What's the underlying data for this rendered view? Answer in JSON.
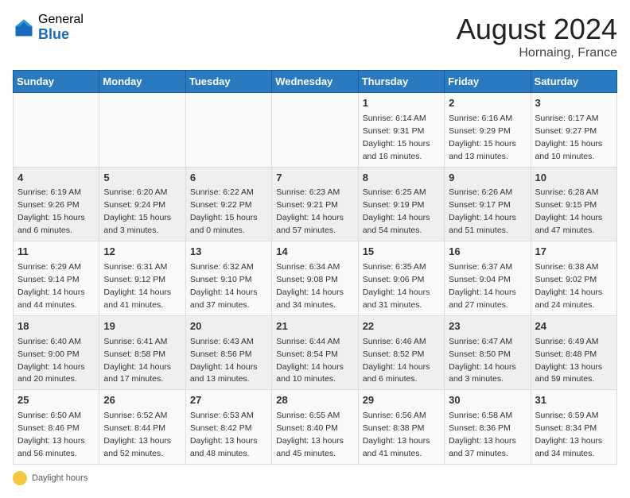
{
  "header": {
    "logo_general": "General",
    "logo_blue": "Blue",
    "month_year": "August 2024",
    "location": "Hornaing, France"
  },
  "footer": {
    "label": "Daylight hours"
  },
  "days_of_week": [
    "Sunday",
    "Monday",
    "Tuesday",
    "Wednesday",
    "Thursday",
    "Friday",
    "Saturday"
  ],
  "weeks": [
    [
      {
        "day": "",
        "info": ""
      },
      {
        "day": "",
        "info": ""
      },
      {
        "day": "",
        "info": ""
      },
      {
        "day": "",
        "info": ""
      },
      {
        "day": "1",
        "info": "Sunrise: 6:14 AM\nSunset: 9:31 PM\nDaylight: 15 hours and 16 minutes."
      },
      {
        "day": "2",
        "info": "Sunrise: 6:16 AM\nSunset: 9:29 PM\nDaylight: 15 hours and 13 minutes."
      },
      {
        "day": "3",
        "info": "Sunrise: 6:17 AM\nSunset: 9:27 PM\nDaylight: 15 hours and 10 minutes."
      }
    ],
    [
      {
        "day": "4",
        "info": "Sunrise: 6:19 AM\nSunset: 9:26 PM\nDaylight: 15 hours and 6 minutes."
      },
      {
        "day": "5",
        "info": "Sunrise: 6:20 AM\nSunset: 9:24 PM\nDaylight: 15 hours and 3 minutes."
      },
      {
        "day": "6",
        "info": "Sunrise: 6:22 AM\nSunset: 9:22 PM\nDaylight: 15 hours and 0 minutes."
      },
      {
        "day": "7",
        "info": "Sunrise: 6:23 AM\nSunset: 9:21 PM\nDaylight: 14 hours and 57 minutes."
      },
      {
        "day": "8",
        "info": "Sunrise: 6:25 AM\nSunset: 9:19 PM\nDaylight: 14 hours and 54 minutes."
      },
      {
        "day": "9",
        "info": "Sunrise: 6:26 AM\nSunset: 9:17 PM\nDaylight: 14 hours and 51 minutes."
      },
      {
        "day": "10",
        "info": "Sunrise: 6:28 AM\nSunset: 9:15 PM\nDaylight: 14 hours and 47 minutes."
      }
    ],
    [
      {
        "day": "11",
        "info": "Sunrise: 6:29 AM\nSunset: 9:14 PM\nDaylight: 14 hours and 44 minutes."
      },
      {
        "day": "12",
        "info": "Sunrise: 6:31 AM\nSunset: 9:12 PM\nDaylight: 14 hours and 41 minutes."
      },
      {
        "day": "13",
        "info": "Sunrise: 6:32 AM\nSunset: 9:10 PM\nDaylight: 14 hours and 37 minutes."
      },
      {
        "day": "14",
        "info": "Sunrise: 6:34 AM\nSunset: 9:08 PM\nDaylight: 14 hours and 34 minutes."
      },
      {
        "day": "15",
        "info": "Sunrise: 6:35 AM\nSunset: 9:06 PM\nDaylight: 14 hours and 31 minutes."
      },
      {
        "day": "16",
        "info": "Sunrise: 6:37 AM\nSunset: 9:04 PM\nDaylight: 14 hours and 27 minutes."
      },
      {
        "day": "17",
        "info": "Sunrise: 6:38 AM\nSunset: 9:02 PM\nDaylight: 14 hours and 24 minutes."
      }
    ],
    [
      {
        "day": "18",
        "info": "Sunrise: 6:40 AM\nSunset: 9:00 PM\nDaylight: 14 hours and 20 minutes."
      },
      {
        "day": "19",
        "info": "Sunrise: 6:41 AM\nSunset: 8:58 PM\nDaylight: 14 hours and 17 minutes."
      },
      {
        "day": "20",
        "info": "Sunrise: 6:43 AM\nSunset: 8:56 PM\nDaylight: 14 hours and 13 minutes."
      },
      {
        "day": "21",
        "info": "Sunrise: 6:44 AM\nSunset: 8:54 PM\nDaylight: 14 hours and 10 minutes."
      },
      {
        "day": "22",
        "info": "Sunrise: 6:46 AM\nSunset: 8:52 PM\nDaylight: 14 hours and 6 minutes."
      },
      {
        "day": "23",
        "info": "Sunrise: 6:47 AM\nSunset: 8:50 PM\nDaylight: 14 hours and 3 minutes."
      },
      {
        "day": "24",
        "info": "Sunrise: 6:49 AM\nSunset: 8:48 PM\nDaylight: 13 hours and 59 minutes."
      }
    ],
    [
      {
        "day": "25",
        "info": "Sunrise: 6:50 AM\nSunset: 8:46 PM\nDaylight: 13 hours and 56 minutes."
      },
      {
        "day": "26",
        "info": "Sunrise: 6:52 AM\nSunset: 8:44 PM\nDaylight: 13 hours and 52 minutes."
      },
      {
        "day": "27",
        "info": "Sunrise: 6:53 AM\nSunset: 8:42 PM\nDaylight: 13 hours and 48 minutes."
      },
      {
        "day": "28",
        "info": "Sunrise: 6:55 AM\nSunset: 8:40 PM\nDaylight: 13 hours and 45 minutes."
      },
      {
        "day": "29",
        "info": "Sunrise: 6:56 AM\nSunset: 8:38 PM\nDaylight: 13 hours and 41 minutes."
      },
      {
        "day": "30",
        "info": "Sunrise: 6:58 AM\nSunset: 8:36 PM\nDaylight: 13 hours and 37 minutes."
      },
      {
        "day": "31",
        "info": "Sunrise: 6:59 AM\nSunset: 8:34 PM\nDaylight: 13 hours and 34 minutes."
      }
    ]
  ]
}
